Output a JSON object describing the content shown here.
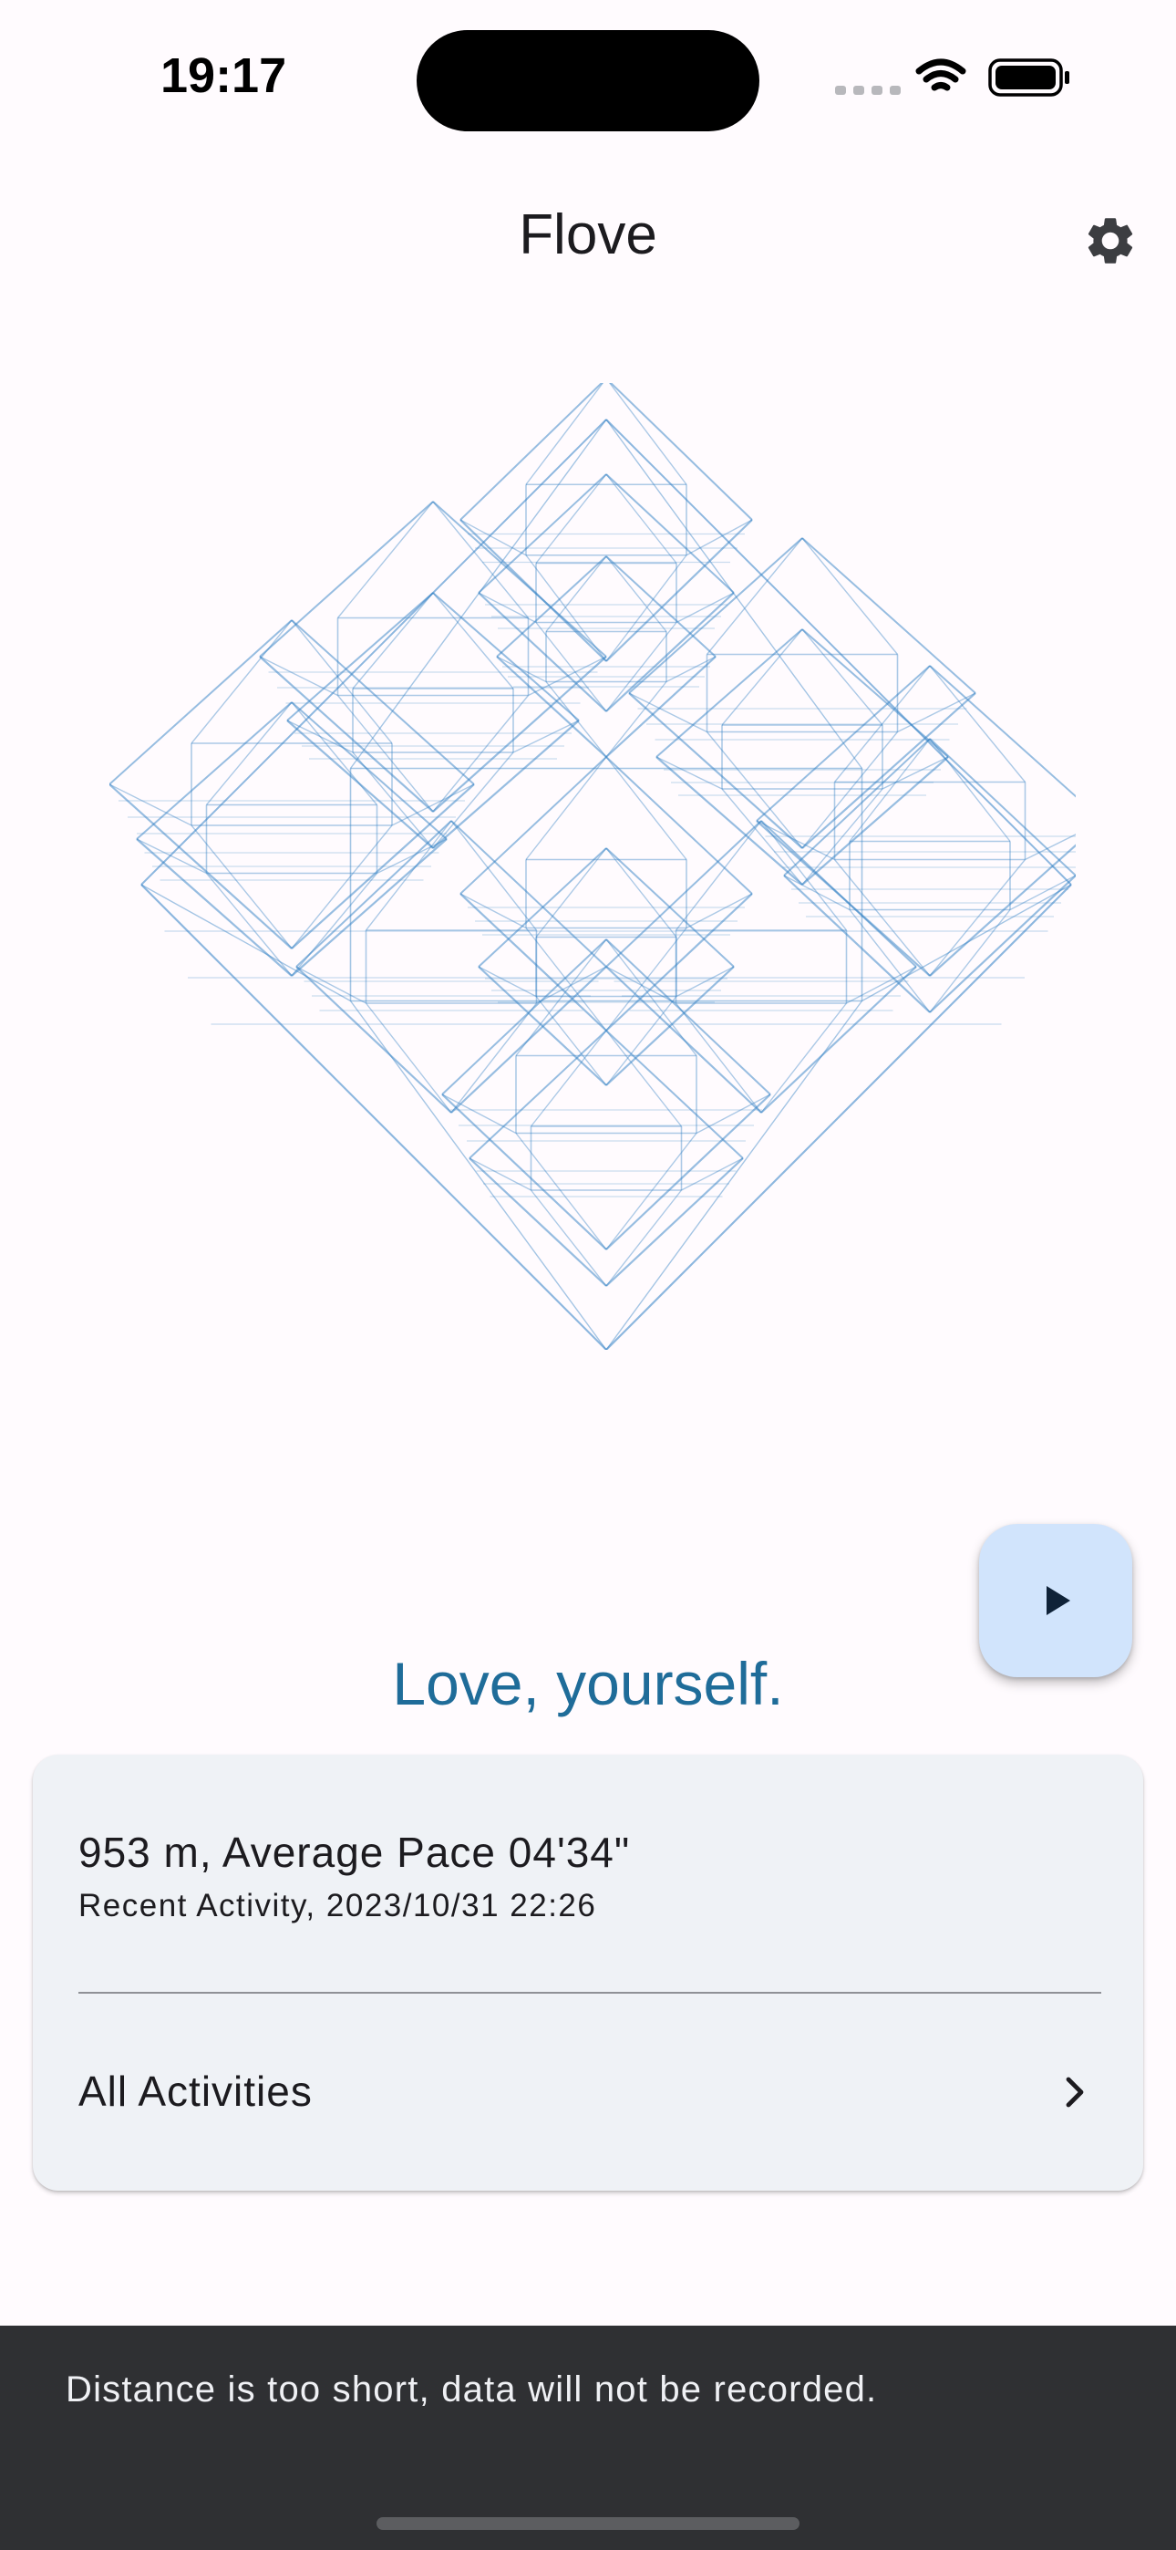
{
  "status_bar": {
    "time": "19:17"
  },
  "app_bar": {
    "title": "Flove",
    "settings_icon": "gear-icon"
  },
  "artwork": {
    "description_icon": "wireframe-pyramid-art",
    "stroke_color": "#2f7fc4"
  },
  "fab": {
    "icon": "play-icon",
    "background": "#d1e4fc"
  },
  "tagline": "Love, yourself.",
  "recent_activity": {
    "title": "953 m, Average Pace 04'34\"",
    "subtitle": "Recent Activity, 2023/10/31 22:26"
  },
  "all_activities": {
    "label": "All Activities",
    "icon": "chevron-right-icon"
  },
  "snackbar": {
    "message": "Distance is too short, data will not be recorded."
  },
  "colors": {
    "accent": "#1f6c99",
    "background": "#fffbfe",
    "card": "#eff2f6",
    "snackbar": "#2f3033"
  }
}
